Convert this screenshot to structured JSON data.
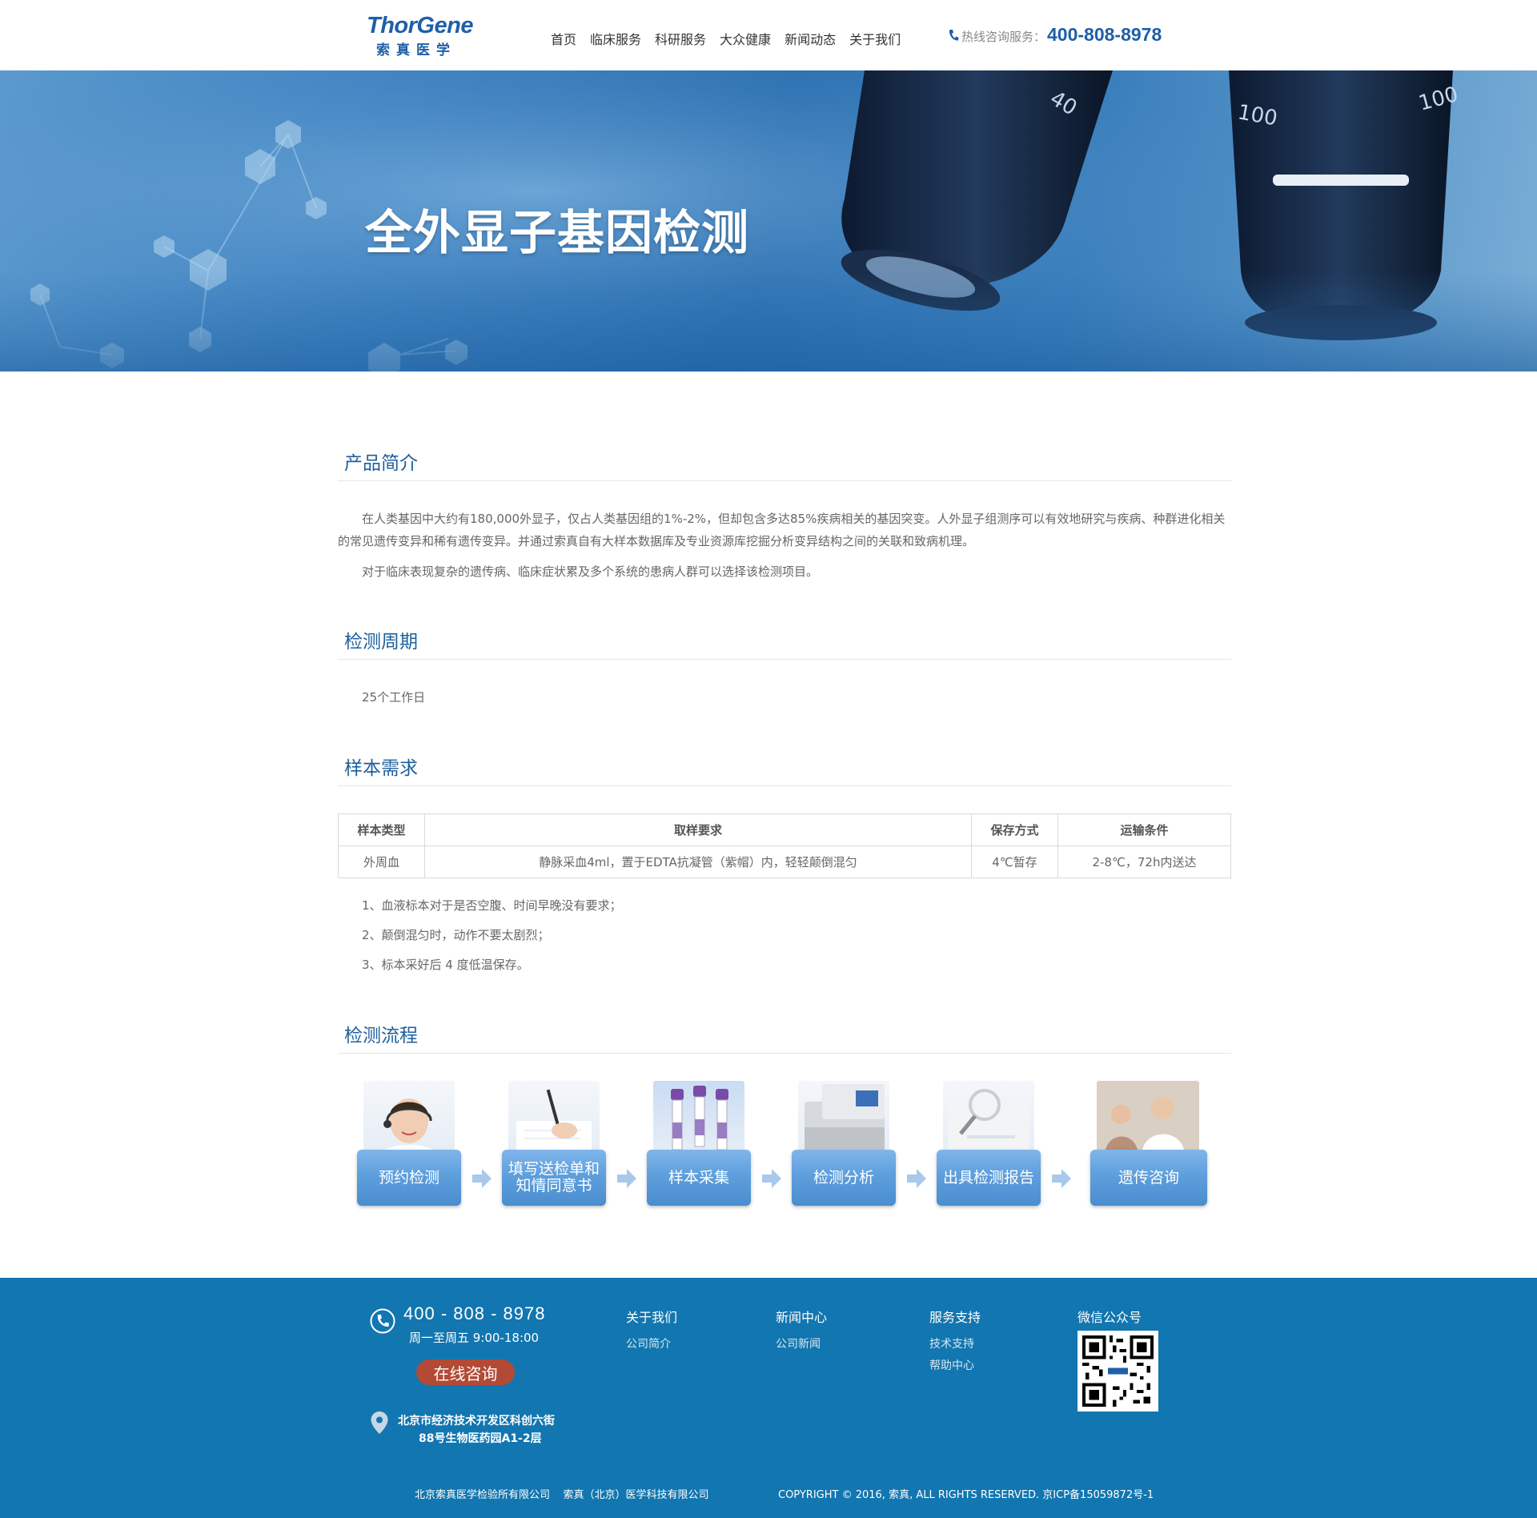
{
  "header": {
    "logo_en": "ThorGene",
    "logo_cn": "索真医学",
    "nav": [
      "首页",
      "临床服务",
      "科研服务",
      "大众健康",
      "新闻动态",
      "关于我们"
    ],
    "hotline_label": "热线咨询服务：",
    "hotline_number": "400-808-8978"
  },
  "banner": {
    "title": "全外显子基因检测",
    "lens_labels": [
      "40",
      "100",
      "100"
    ]
  },
  "intro": {
    "title": "产品简介",
    "p1": "在人类基因中大约有180,000外显子，仅占人类基因组的1%-2%，但却包含多达85%疾病相关的基因突变。人外显子组测序可以有效地研究与疾病、种群进化相关的常见遗传变异和稀有遗传变异。并通过索真自有大样本数据库及专业资源库挖掘分析变异结构之间的关联和致病机理。",
    "p2": "对于临床表现复杂的遗传病、临床症状累及多个系统的患病人群可以选择该检测项目。"
  },
  "cycle": {
    "title": "检测周期",
    "text": "25个工作日"
  },
  "sample": {
    "title": "样本需求",
    "headers": [
      "样本类型",
      "取样要求",
      "保存方式",
      "运输条件"
    ],
    "row": [
      "外周血",
      "静脉采血4ml，置于EDTA抗凝管（紫帽）内，轻轻颠倒混匀",
      "4℃暂存",
      "2-8℃，72h内送达"
    ],
    "notes": [
      "1、血液标本对于是否空腹、时间早晚没有要求；",
      "2、颠倒混匀时，动作不要太剧烈；",
      "3、标本采好后 4 度低温保存。"
    ]
  },
  "process": {
    "title": "检测流程",
    "steps": [
      "预约检测",
      "填写送检单和知情同意书",
      "样本采集",
      "检测分析",
      "出具检测报告",
      "遗传咨询"
    ]
  },
  "footer": {
    "phone": "400 - 808 - 8978",
    "hours": "周一至周五 9:00-18:00",
    "consult": "在线咨询",
    "address_line1": "北京市经济技术开发区科创六街",
    "address_line2": "88号生物医药园A1-2层",
    "col_about": {
      "title": "关于我们",
      "links": [
        "公司简介"
      ]
    },
    "col_news": {
      "title": "新闻中心",
      "links": [
        "公司新闻"
      ]
    },
    "col_support": {
      "title": "服务支持",
      "links": [
        "技术支持",
        "帮助中心"
      ]
    },
    "wechat_title": "微信公众号",
    "companies": "北京索真医学检验所有限公司    索真（北京）医学科技有限公司",
    "copyright": "COPYRIGHT © 2016, 索真, ALL RIGHTS RESERVED. 京ICP备15059872号-1"
  },
  "colors": {
    "brand_blue": "#1e5fa8",
    "footer_blue": "#1276b0",
    "consult_red": "#b24a36",
    "step_blue": "#5e9fdc"
  }
}
